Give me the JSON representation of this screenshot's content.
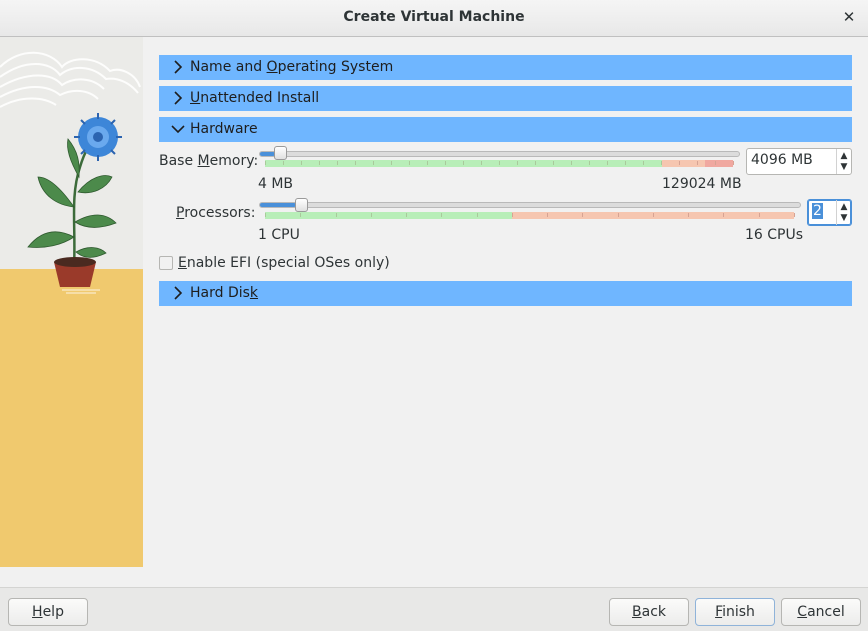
{
  "window": {
    "title": "Create Virtual Machine",
    "close_glyph": "✕"
  },
  "sections": {
    "name_os": {
      "label_pre": "Name and ",
      "label_mn": "O",
      "label_post": "perating System",
      "icon": "chevron-right-icon"
    },
    "unattended": {
      "label_pre": "",
      "label_mn": "U",
      "label_post": "nattended Install",
      "icon": "chevron-right-icon"
    },
    "hardware": {
      "label": "Hardware",
      "icon": "chevron-down-icon",
      "expanded": true
    },
    "hard_disk": {
      "label_pre": "Hard Dis",
      "label_mn": "k",
      "label_post": "",
      "icon": "chevron-right-icon"
    }
  },
  "hardware": {
    "memory": {
      "label_pre": "Base ",
      "label_mn": "M",
      "label_post": "emory:",
      "value": "4096 MB",
      "min_label": "4 MB",
      "max_label": "129024 MB",
      "value_mb": 4096,
      "min_mb": 4,
      "max_mb": 129024
    },
    "processors": {
      "label_pre": "",
      "label_mn": "P",
      "label_post": "rocessors:",
      "value": "2",
      "min_label": "1 CPU",
      "max_label": "16 CPUs",
      "value_cpus": 2,
      "min_cpus": 1,
      "max_cpus": 16
    },
    "efi": {
      "label_pre": "",
      "label_mn": "E",
      "label_post": "nable EFI (special OSes only)",
      "checked": false
    }
  },
  "footer": {
    "help": {
      "pre": "",
      "mn": "H",
      "post": "elp"
    },
    "back": {
      "pre": "",
      "mn": "B",
      "post": "ack"
    },
    "finish": {
      "pre": "",
      "mn": "F",
      "post": "inish"
    },
    "cancel": {
      "pre": "",
      "mn": "C",
      "post": "ancel"
    }
  },
  "colors": {
    "section_header": "#6fb6ff",
    "zone_ok": "#b8eeb8",
    "zone_warn": "#f6c6b0",
    "zone_bad": "#f0a8a0",
    "floor": "#f0c96e",
    "flower": "#3d86d8"
  }
}
